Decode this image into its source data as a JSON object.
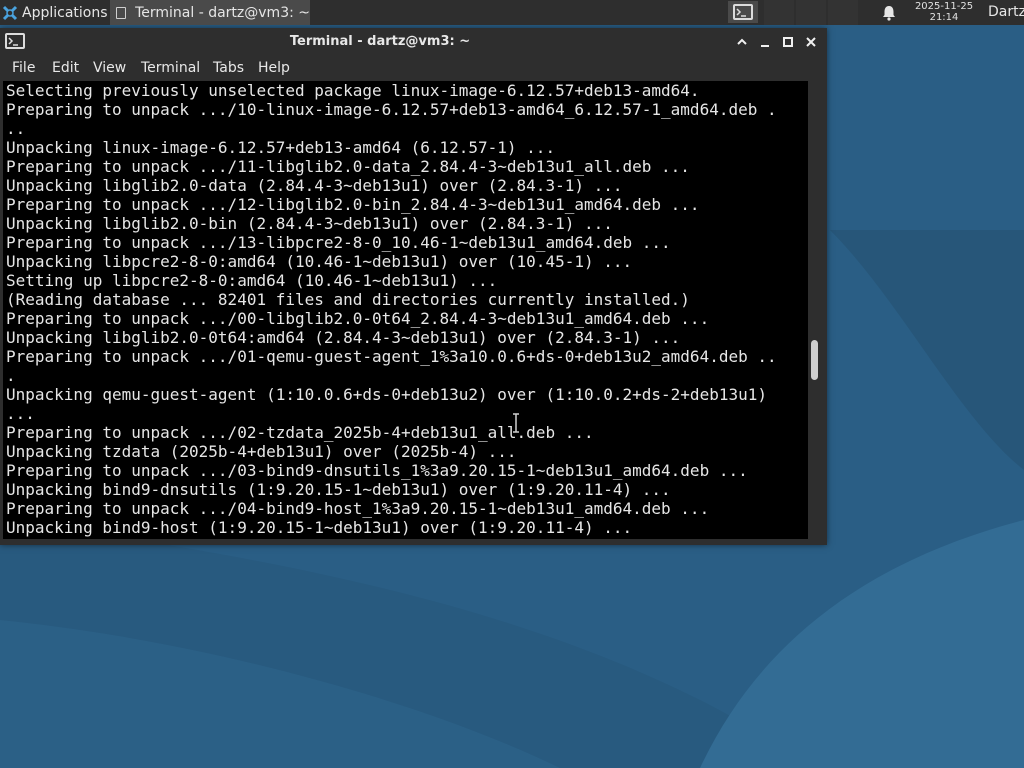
{
  "panel": {
    "apps_label": "Applications",
    "task_label": "Terminal - dartz@vm3: ~",
    "clock_date": "2025-11-25",
    "clock_time": "21:14",
    "user": "Dartz",
    "icons": {
      "apps": "xfce-logo-icon",
      "task": "terminal-icon",
      "notifications": "bell-icon"
    }
  },
  "window": {
    "title": "Terminal - dartz@vm3: ~",
    "controls": [
      "maximize-up",
      "minimize",
      "maximize",
      "close"
    ],
    "menu": [
      "File",
      "Edit",
      "View",
      "Terminal",
      "Tabs",
      "Help"
    ]
  },
  "terminal": {
    "lines": [
      "Selecting previously unselected package linux-image-6.12.57+deb13-amd64.",
      "Preparing to unpack .../10-linux-image-6.12.57+deb13-amd64_6.12.57-1_amd64.deb .",
      "..",
      "Unpacking linux-image-6.12.57+deb13-amd64 (6.12.57-1) ...",
      "Preparing to unpack .../11-libglib2.0-data_2.84.4-3~deb13u1_all.deb ...",
      "Unpacking libglib2.0-data (2.84.4-3~deb13u1) over (2.84.3-1) ...",
      "Preparing to unpack .../12-libglib2.0-bin_2.84.4-3~deb13u1_amd64.deb ...",
      "Unpacking libglib2.0-bin (2.84.4-3~deb13u1) over (2.84.3-1) ...",
      "Preparing to unpack .../13-libpcre2-8-0_10.46-1~deb13u1_amd64.deb ...",
      "Unpacking libpcre2-8-0:amd64 (10.46-1~deb13u1) over (10.45-1) ...",
      "Setting up libpcre2-8-0:amd64 (10.46-1~deb13u1) ...",
      "(Reading database ... 82401 files and directories currently installed.)",
      "Preparing to unpack .../00-libglib2.0-0t64_2.84.4-3~deb13u1_amd64.deb ...",
      "Unpacking libglib2.0-0t64:amd64 (2.84.4-3~deb13u1) over (2.84.3-1) ...",
      "Preparing to unpack .../01-qemu-guest-agent_1%3a10.0.6+ds-0+deb13u2_amd64.deb ..",
      ".",
      "Unpacking qemu-guest-agent (1:10.0.6+ds-0+deb13u2) over (1:10.0.2+ds-2+deb13u1)",
      "...",
      "Preparing to unpack .../02-tzdata_2025b-4+deb13u1_all.deb ...",
      "Unpacking tzdata (2025b-4+deb13u1) over (2025b-4) ...",
      "Preparing to unpack .../03-bind9-dnsutils_1%3a9.20.15-1~deb13u1_amd64.deb ...",
      "Unpacking bind9-dnsutils (1:9.20.15-1~deb13u1) over (1:9.20.11-4) ...",
      "Preparing to unpack .../04-bind9-host_1%3a9.20.15-1~deb13u1_amd64.deb ...",
      "Unpacking bind9-host (1:9.20.15-1~deb13u1) over (1:9.20.11-4) ..."
    ],
    "scroll_position": 0.62
  },
  "colors": {
    "panel_bg": "#2e2e2e",
    "terminal_bg": "#000000",
    "terminal_fg": "#e6e6e6",
    "desktop_bg": "#2b5f86"
  }
}
